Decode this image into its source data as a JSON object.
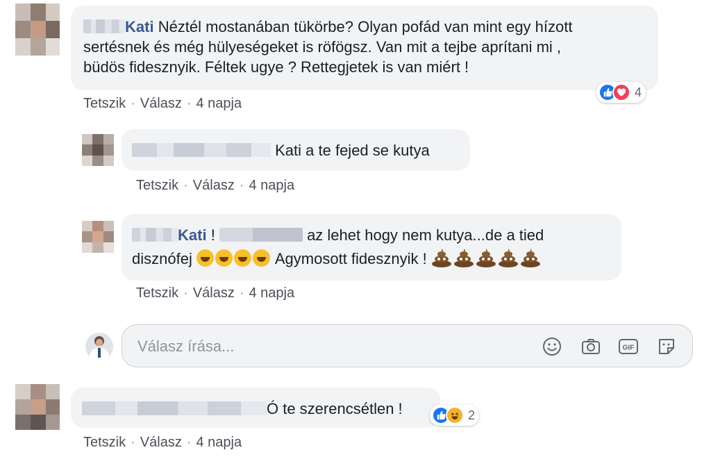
{
  "comments": [
    {
      "author_visible": "Kati",
      "text": "Néztél mostanában tükörbe? Olyan pofád van mint egy hízott sertésnek és még hülyeségeket is röfögsz. Van mit a tejbe aprítani mi , büdös fidesznyik. Féltek ugye ? Rettegjetek is van miért !",
      "line1": "Néztél mostanában tükörbe? Olyan pofád van mint egy hízott",
      "line2": "sertésnek és még hülyeségeket is röfögsz. Van mit a tejbe aprítani mi ,",
      "line3": "büdös fidesznyik. Féltek ugye ? Rettegjetek is van miért !",
      "reactions": {
        "types": [
          "like-icon",
          "love-icon"
        ],
        "count": "4"
      },
      "actions": {
        "like": "Tetszik",
        "reply": "Válasz",
        "time": "4 napja"
      },
      "replies": [
        {
          "text": "Kati a te fejed se kutya",
          "actions": {
            "like": "Tetszik",
            "reply": "Válasz",
            "time": "4 napja"
          }
        },
        {
          "author_visible": "Kati",
          "part1": "!",
          "part2": "az lehet hogy nem kutya...de a tied",
          "part3": "disznófej",
          "part4": "Agymosott fidesznyik !",
          "emoji_laugh_count": 4,
          "emoji_poo_count": 5,
          "actions": {
            "like": "Tetszik",
            "reply": "Válasz",
            "time": "4 napja"
          }
        }
      ]
    },
    {
      "text": "Ó te szerencsétlen !",
      "reactions": {
        "types": [
          "like-icon",
          "haha-icon"
        ],
        "count": "2"
      },
      "actions": {
        "like": "Tetszik",
        "reply": "Válasz",
        "time": "4 napja"
      }
    }
  ],
  "reply_input": {
    "placeholder": "Válasz írása...",
    "tools": [
      "emoji-icon",
      "camera-icon",
      "gif-icon",
      "sticker-icon"
    ]
  },
  "colors": {
    "name": "#385898",
    "bubble": "#f2f3f5",
    "like": "#1877f2",
    "love": "#f33e58",
    "haha": "#f7b125"
  }
}
